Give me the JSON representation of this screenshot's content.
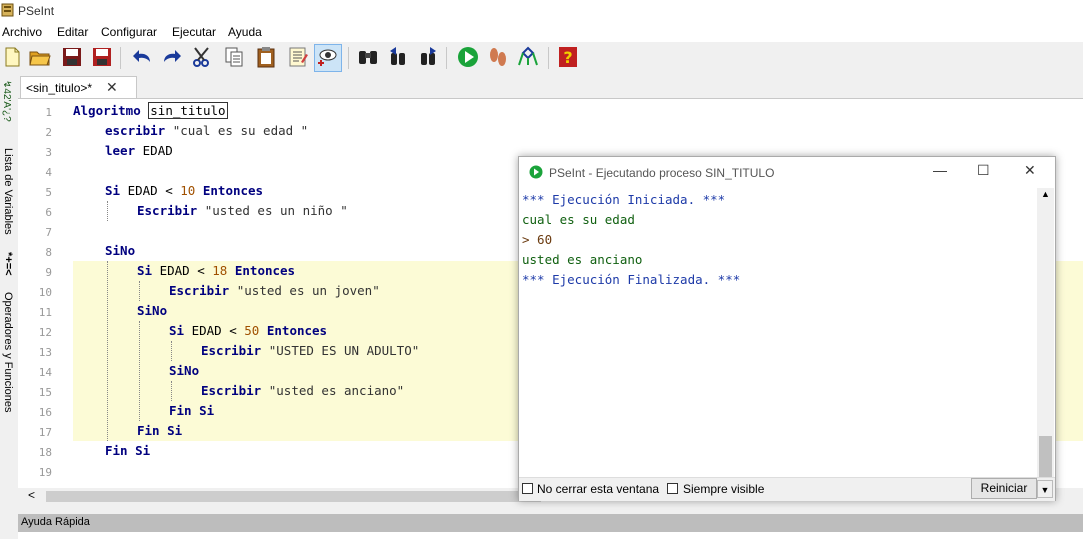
{
  "app": {
    "title": "PSeInt"
  },
  "menu": [
    "Archivo",
    "Editar",
    "Configurar",
    "Ejecutar",
    "Ayuda"
  ],
  "toolbar": {
    "icons": [
      "new-file-icon",
      "open-folder-icon",
      "save-icon",
      "save-as-icon",
      "undo-icon",
      "redo-icon",
      "cut-icon",
      "copy-icon",
      "paste-icon",
      "edit-list-icon",
      "step-view-icon",
      "search-binoculars-icon",
      "find-prev-icon",
      "find-next-icon",
      "run-icon",
      "step-by-step-icon",
      "flowchart-icon",
      "help-icon"
    ]
  },
  "sidebar": {
    "variables_label": "Lista de Variables",
    "operators_label": "Operadores y Funciones",
    "var_glyph": "*+=<"
  },
  "tab": {
    "label": "<sin_titulo>*",
    "close": "✕"
  },
  "editor": {
    "line_numbers": [
      "1",
      "2",
      "3",
      "4",
      "5",
      "6",
      "7",
      "8",
      "9",
      "10",
      "11",
      "12",
      "13",
      "14",
      "15",
      "16",
      "17",
      "18",
      "19"
    ],
    "lines": {
      "l1_kw": "Algoritmo",
      "l1_name": "sin_titulo",
      "l2_kw": "escribir",
      "l2_str": "\"cual es su edad \"",
      "l3_kw": "leer",
      "l3_id": "EDAD",
      "l5_kw1": "Si",
      "l5_id": "EDAD <",
      "l5_num": "10",
      "l5_kw2": "Entonces",
      "l6_kw": "Escribir",
      "l6_str": "\"usted es un niño \"",
      "l8_kw": "SiNo",
      "l9_kw1": "Si",
      "l9_id": "EDAD <",
      "l9_num": "18",
      "l9_kw2": "Entonces",
      "l10_kw": "Escribir",
      "l10_str": "\"usted es un joven\"",
      "l11_kw": "SiNo",
      "l12_kw1": "Si",
      "l12_id": "EDAD <",
      "l12_num": "50",
      "l12_kw2": "Entonces",
      "l13_kw": "Escribir",
      "l13_str": "\"USTED ES UN ADULTO\"",
      "l14_kw": "SiNo",
      "l15_kw": "Escribir",
      "l15_str": "\"usted es anciano\"",
      "l16_kw": "Fin Si",
      "l17_kw": "Fin Si",
      "l18_kw": "Fin Si"
    }
  },
  "scroll": {
    "left_arrow": "<"
  },
  "quick_help": {
    "label": "Ayuda Rápida"
  },
  "run_window": {
    "title": "PSeInt - Ejecutando proceso SIN_TITULO",
    "minimize": "—",
    "maximize": "☐",
    "close": "✕",
    "console": [
      {
        "text": "*** Ejecución Iniciada. ***",
        "style": "blue"
      },
      {
        "text": "cual es su edad",
        "style": "green"
      },
      {
        "text": "> 60",
        "style": "brown"
      },
      {
        "text": "usted es anciano",
        "style": "green"
      },
      {
        "text": "*** Ejecución Finalizada. ***",
        "style": "blue"
      }
    ],
    "checkbox1": "No cerrar esta ventana",
    "checkbox2": "Siempre visible",
    "restart_button": "Reiniciar",
    "dropdown_glyph": "▼",
    "scroll_up": "▲"
  },
  "colors": {
    "keyword": "#00007f",
    "highlight": "#fcfbd6",
    "console_blue": "#1d3aa8",
    "console_green": "#106010"
  }
}
